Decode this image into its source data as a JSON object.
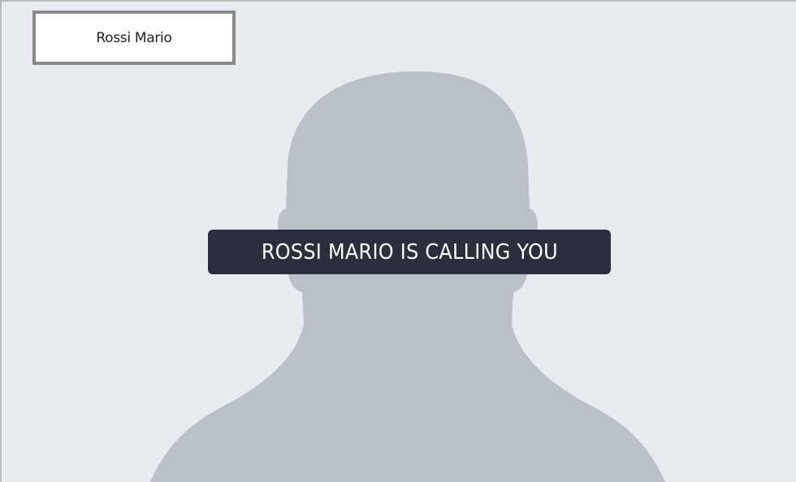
{
  "caller": {
    "name_label": "Rossi Mario",
    "status_message": "ROSSI MARIO IS CALLING YOU"
  },
  "avatar": {
    "icon": "person-silhouette-icon",
    "silhouette_color": "#bac0c7",
    "background_color": "#e8ebef"
  },
  "colors": {
    "banner_background": "#2b2e3d",
    "banner_text": "#ffffff",
    "name_box_border": "#8a8a8a"
  }
}
